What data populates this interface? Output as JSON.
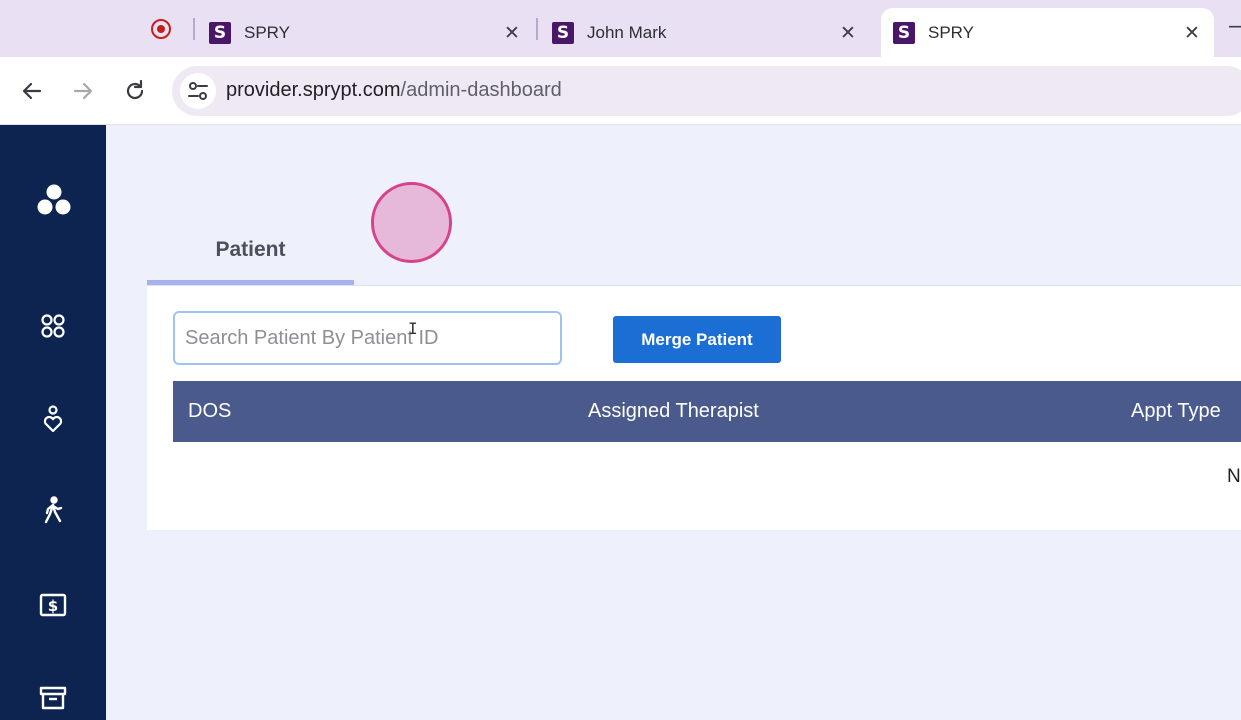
{
  "browser": {
    "tabs": [
      {
        "title": "SPRY",
        "favicon": "S",
        "active": false
      },
      {
        "title": "John Mark",
        "favicon": "S",
        "active": false
      },
      {
        "title": "SPRY",
        "favicon": "S",
        "active": true
      }
    ],
    "close_glyph": "✕",
    "address": {
      "host": "provider.sprypt.com",
      "path": "/admin-dashboard"
    }
  },
  "sidebar": {
    "items": [
      {
        "icon": "logo-icon"
      },
      {
        "icon": "dashboard-grid-icon"
      },
      {
        "icon": "patient-care-icon"
      },
      {
        "icon": "walking-person-icon"
      },
      {
        "icon": "billing-dollar-icon"
      },
      {
        "icon": "archive-box-icon"
      }
    ],
    "color": "#0d2450"
  },
  "main": {
    "tab_label": "Patient",
    "search_placeholder": "Search Patient By Patient ID",
    "merge_button": "Merge Patient",
    "table": {
      "headers": [
        "DOS",
        "Assigned Therapist",
        "Appt Type"
      ],
      "empty_text": "No"
    },
    "accent": "#1b6ed4",
    "header_bg": "#4a5a8c"
  }
}
